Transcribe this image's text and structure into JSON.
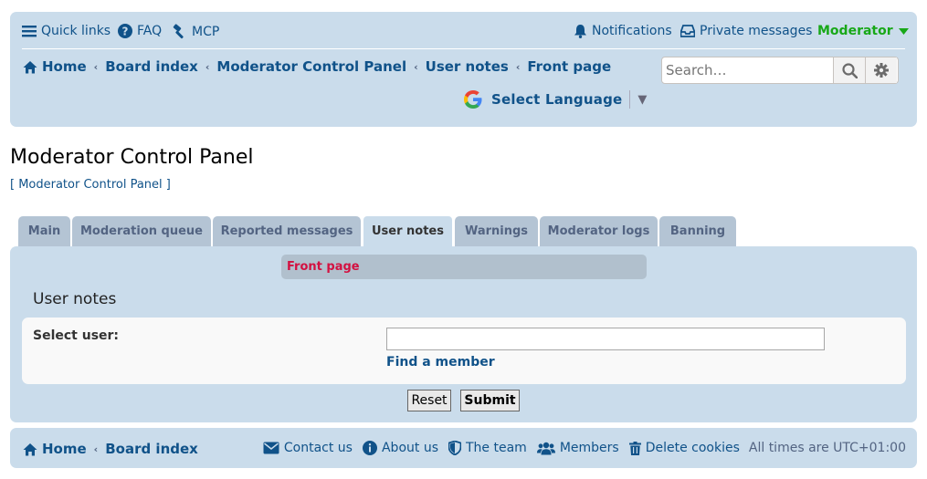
{
  "topbar": {
    "quick_links": "Quick links",
    "faq": "FAQ",
    "mcp": "MCP",
    "notifications": "Notifications",
    "private_messages": "Private messages",
    "user": "Moderator"
  },
  "breadcrumbs": [
    "Home",
    "Board index",
    "Moderator Control Panel",
    "User notes",
    "Front page"
  ],
  "search": {
    "placeholder": "Search…"
  },
  "language": {
    "label": "Select Language"
  },
  "page": {
    "title": "Moderator Control Panel",
    "subtitle": "[ Moderator Control Panel ]"
  },
  "tabs": [
    {
      "label": "Main"
    },
    {
      "label": "Moderation queue"
    },
    {
      "label": "Reported messages"
    },
    {
      "label": "User notes",
      "active": true
    },
    {
      "label": "Warnings"
    },
    {
      "label": "Moderator logs"
    },
    {
      "label": "Banning"
    }
  ],
  "panel": {
    "subtab": "Front page",
    "heading": "User notes",
    "select_user_label": "Select user:",
    "select_user_value": "",
    "find_member": "Find a member",
    "reset_label": "Reset",
    "submit_label": "Submit"
  },
  "footer": {
    "breadcrumbs": [
      "Home",
      "Board index"
    ],
    "contact": "Contact us",
    "about": "About us",
    "team": "The team",
    "members": "Members",
    "delete_cookies": "Delete cookies",
    "timezone": "All times are UTC+01:00"
  },
  "colors": {
    "panel_bg": "#cadceb",
    "link": "#105289",
    "active_subtab_text": "#d31141",
    "user_green": "#18a818"
  }
}
